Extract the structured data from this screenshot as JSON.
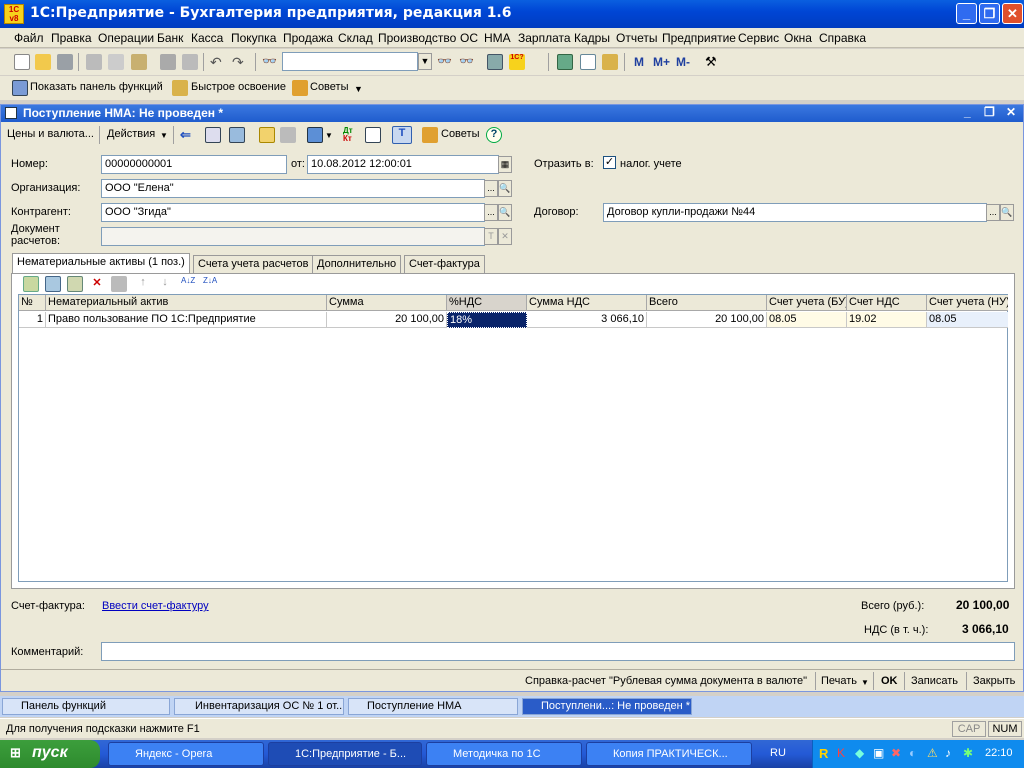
{
  "app": {
    "title": "1С:Предприятие - Бухгалтерия предприятия, редакция 1.6",
    "logo_text": "1С v8"
  },
  "menu": [
    "Файл",
    "Правка",
    "Операции",
    "Банк",
    "Касса",
    "Покупка",
    "Продажа",
    "Склад",
    "Производство",
    "ОС",
    "НМА",
    "Зарплата",
    "Кадры",
    "Отчеты",
    "Предприятие",
    "Сервис",
    "Окна",
    "Справка"
  ],
  "toolbar2": {
    "show_panel": "Показать панель функций",
    "quick_learn": "Быстрое освоение",
    "tips": "Советы"
  },
  "toolbar1": {
    "search_value": "",
    "m_buttons": [
      "M",
      "M+",
      "M-"
    ]
  },
  "document": {
    "title": "Поступление НМА: Не проведен *",
    "toolbar": {
      "prices": "Цены и валюта...",
      "actions": "Действия",
      "tips": "Советы"
    },
    "number_label": "Номер:",
    "number_value": "00000000001",
    "date_label": "от:",
    "date_value": "10.08.2012 12:00:01",
    "reflect_label": "Отразить в:",
    "tax_check_label": "налог. учете",
    "tax_checked": true,
    "org_label": "Организация:",
    "org_value": "ООО \"Елена\"",
    "contractor_label": "Контрагент:",
    "contractor_value": "ООО \"Згида\"",
    "contract_label": "Договор:",
    "contract_value": "Договор купли-продажи №44",
    "settlement_label_1": "Документ",
    "settlement_label_2": "расчетов:",
    "settlement_value": "",
    "tabs": [
      "Нематериальные активы (1 поз.)",
      "Счета учета расчетов",
      "Дополнительно",
      "Счет-фактура"
    ],
    "grid": {
      "columns": [
        "№",
        "Нематериальный актив",
        "Сумма",
        "%НДС",
        "Сумма НДС",
        "Всего",
        "Счет учета (БУ)",
        "Счет НДС",
        "Счет учета (НУ)"
      ],
      "rows": [
        [
          "1",
          "Право пользование ПО 1С:Предприятие",
          "20 100,00",
          "18%",
          "3 066,10",
          "20 100,00",
          "08.05",
          "19.02",
          "08.05"
        ]
      ]
    },
    "invoice_label": "Счет-фактура:",
    "invoice_link": "Ввести счет-фактуру",
    "total_label": "Всего (руб.):",
    "total_value": "20 100,00",
    "vat_label": "НДС (в т. ч.):",
    "vat_value": "3 066,10",
    "comment_label": "Комментарий:",
    "comment_value": "",
    "bottom": {
      "calc": "Справка-расчет \"Рублевая сумма документа в валюте\"",
      "print": "Печать",
      "ok": "OK",
      "save": "Записать",
      "close": "Закрыть"
    }
  },
  "task_panel": [
    "Панель функций",
    "Инвентаризация ОС № 1 от...",
    "Поступление НМА",
    "Поступлени...: Не проведен *"
  ],
  "status": {
    "hint": "Для получения подсказки нажмите F1",
    "cap": "CAP",
    "num": "NUM"
  },
  "taskbar": {
    "start": "пуск",
    "items": [
      "Яндекс - Opera",
      "1С:Предприятие - Б...",
      "Методичка по 1С",
      "Копия ПРАКТИЧЕСК..."
    ],
    "lang": "RU",
    "clock": "22:10"
  },
  "colors": {
    "xp_blue": "#0046d5",
    "selected_cell": "#0a246a",
    "row_highlight": "#fffbe6"
  }
}
